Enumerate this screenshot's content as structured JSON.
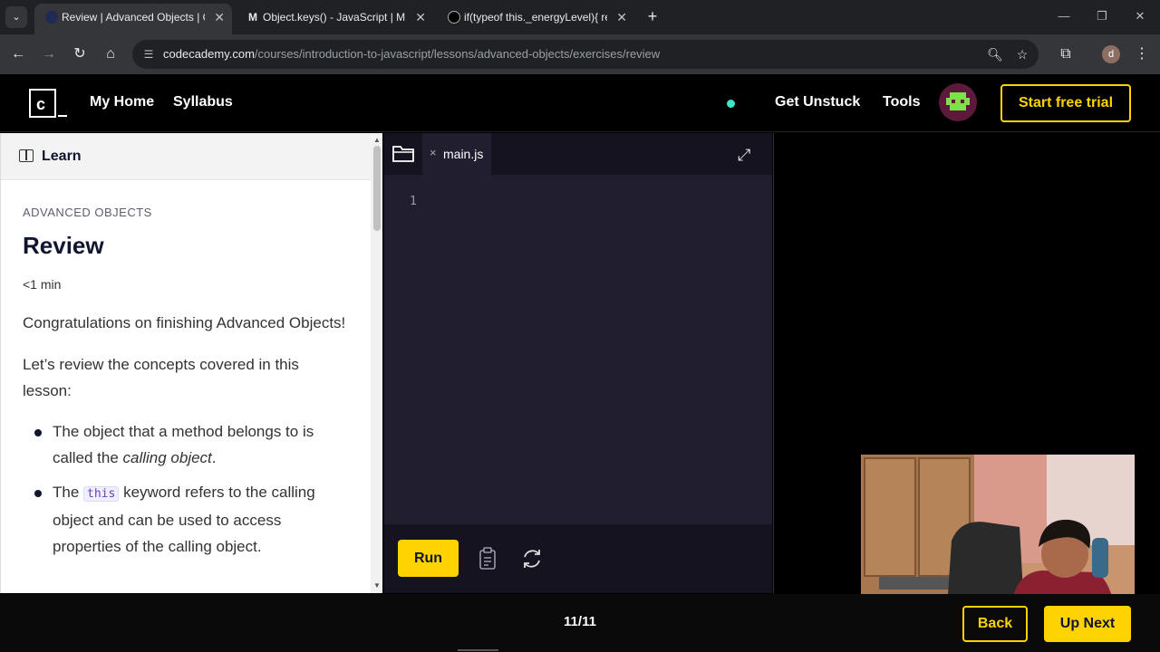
{
  "browser": {
    "tabs": [
      {
        "title": "Review | Advanced Objects | Co",
        "favicon": "codecademy-icon",
        "active": true
      },
      {
        "title": "Object.keys() - JavaScript | MDN",
        "favicon": "mdn-icon",
        "active": false
      },
      {
        "title": "if(typeof this._energyLevel){ retu",
        "favicon": "chatgpt-icon",
        "active": false
      }
    ],
    "url_host": "codecademy.com",
    "url_path": "/courses/introduction-to-javascript/lessons/advanced-objects/exercises/review",
    "profile_initial": "d"
  },
  "header": {
    "nav": [
      "My Home",
      "Syllabus"
    ],
    "get_unstuck": "Get Unstuck",
    "tools": "Tools",
    "trial_label": "Start free trial",
    "accent": "#ffd300"
  },
  "learn": {
    "tab_label": "Learn",
    "eyebrow": "ADVANCED OBJECTS",
    "title": "Review",
    "duration": "<1 min",
    "para1": "Congratulations on finishing Advanced Objects!",
    "para2": "Let’s review the concepts covered in this lesson:",
    "bullet1_a": "The object that a method belongs to is called the ",
    "bullet1_em": "calling object",
    "bullet1_b": ".",
    "bullet2_a": "The ",
    "bullet2_code": "this",
    "bullet2_b": " keyword refers to the calling object and can be used to access properties of the calling object."
  },
  "editor": {
    "file_name": "main.js",
    "line_numbers": [
      "1"
    ],
    "run_label": "Run"
  },
  "footer": {
    "progress": "11/11",
    "back_label": "Back",
    "next_label": "Up Next"
  }
}
